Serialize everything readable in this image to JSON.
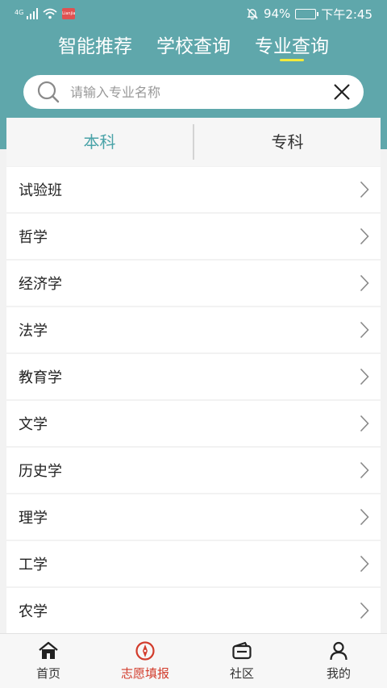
{
  "status_bar": {
    "network": "4G",
    "battery": "94%",
    "time": "下午2:45",
    "app_badge": "Lianjia"
  },
  "top_tabs": [
    {
      "label": "智能推荐",
      "active": false
    },
    {
      "label": "学校查询",
      "active": false
    },
    {
      "label": "专业查询",
      "active": true
    }
  ],
  "search": {
    "placeholder": "请输入专业名称",
    "value": ""
  },
  "level_tabs": [
    {
      "label": "本科",
      "active": true
    },
    {
      "label": "专科",
      "active": false
    }
  ],
  "majors": [
    "试验班",
    "哲学",
    "经济学",
    "法学",
    "教育学",
    "文学",
    "历史学",
    "理学",
    "工学",
    "农学"
  ],
  "bottom_nav": [
    {
      "label": "首页",
      "icon": "home-icon",
      "active": false
    },
    {
      "label": "志愿填报",
      "icon": "compass-icon",
      "active": true
    },
    {
      "label": "社区",
      "icon": "wallet-icon",
      "active": false
    },
    {
      "label": "我的",
      "icon": "user-icon",
      "active": false
    }
  ],
  "colors": {
    "header": "#5fa7ab",
    "accent": "#4aa3a8",
    "tab_underline": "#f2ea3b",
    "nav_active": "#d23c2c"
  }
}
